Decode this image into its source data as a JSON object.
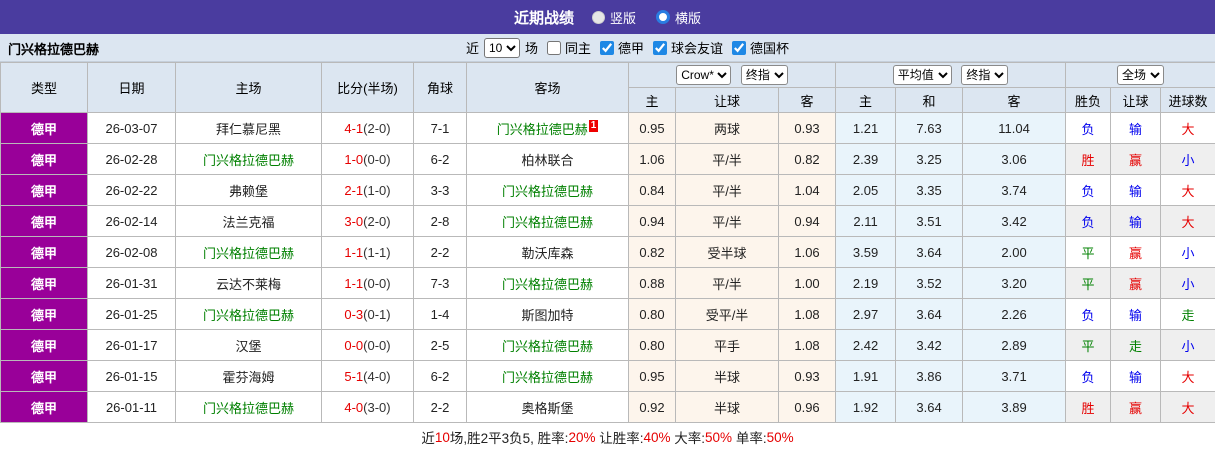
{
  "colors": {
    "topbar_bg": "#4a3c9f",
    "league_cell_bg": "#990099",
    "header_bg": "#dce6f1",
    "odds_bg": "#fdf5ec",
    "avg_bg": "#e9f4fb",
    "alt_row_bg": "#efefef",
    "red": "#e60000",
    "blue": "#0000ee",
    "green": "#008000",
    "checkbox_blue": "#1e88e5"
  },
  "topbar": {
    "title": "近期战绩",
    "radio_vertical": "竖版",
    "radio_horizontal": "横版"
  },
  "filterbar": {
    "team": "门兴格拉德巴赫",
    "near": "近",
    "count": "10",
    "unit": "场",
    "same_home": "同主",
    "league_filters": [
      {
        "label": "德甲",
        "checked": true
      },
      {
        "label": "球会友谊",
        "checked": true
      },
      {
        "label": "德国杯",
        "checked": true
      }
    ]
  },
  "table": {
    "left_headers": [
      "类型",
      "日期",
      "主场",
      "比分(半场)",
      "角球",
      "客场"
    ],
    "selects": {
      "company": "Crow*",
      "stage1": "终指",
      "average": "平均值",
      "stage2": "终指",
      "scope": "全场"
    },
    "sub_headers": [
      "主",
      "让球",
      "客",
      "主",
      "和",
      "客",
      "胜负",
      "让球",
      "进球数"
    ],
    "rows": [
      {
        "type": "德甲",
        "date": "26-03-07",
        "home": {
          "name": "拜仁慕尼黑",
          "color": "black"
        },
        "score": {
          "full": "4-1",
          "half": "(2-0)"
        },
        "corner": "7-1",
        "away": {
          "name": "门兴格拉德巴赫",
          "color": "green",
          "badge": "1"
        },
        "odds": {
          "home": "0.95",
          "handicap": "两球",
          "away": "0.93"
        },
        "avg": {
          "home": "1.21",
          "draw": "7.63",
          "away": "11.04"
        },
        "results": {
          "outcome": {
            "text": "负",
            "color": "blue"
          },
          "handicap": {
            "text": "输",
            "color": "blue"
          },
          "goals": {
            "text": "大",
            "color": "red"
          }
        }
      },
      {
        "type": "德甲",
        "date": "26-02-28",
        "home": {
          "name": "门兴格拉德巴赫",
          "color": "green"
        },
        "score": {
          "full": "1-0",
          "half": "(0-0)"
        },
        "corner": "6-2",
        "away": {
          "name": "柏林联合",
          "color": "black"
        },
        "odds": {
          "home": "1.06",
          "handicap": "平/半",
          "away": "0.82"
        },
        "avg": {
          "home": "2.39",
          "draw": "3.25",
          "away": "3.06"
        },
        "results": {
          "outcome": {
            "text": "胜",
            "color": "red"
          },
          "handicap": {
            "text": "赢",
            "color": "red"
          },
          "goals": {
            "text": "小",
            "color": "blue"
          }
        }
      },
      {
        "type": "德甲",
        "date": "26-02-22",
        "home": {
          "name": "弗赖堡",
          "color": "black"
        },
        "score": {
          "full": "2-1",
          "half": "(1-0)"
        },
        "corner": "3-3",
        "away": {
          "name": "门兴格拉德巴赫",
          "color": "green"
        },
        "odds": {
          "home": "0.84",
          "handicap": "平/半",
          "away": "1.04"
        },
        "avg": {
          "home": "2.05",
          "draw": "3.35",
          "away": "3.74"
        },
        "results": {
          "outcome": {
            "text": "负",
            "color": "blue"
          },
          "handicap": {
            "text": "输",
            "color": "blue"
          },
          "goals": {
            "text": "大",
            "color": "red"
          }
        }
      },
      {
        "type": "德甲",
        "date": "26-02-14",
        "home": {
          "name": "法兰克福",
          "color": "black"
        },
        "score": {
          "full": "3-0",
          "half": "(2-0)"
        },
        "corner": "2-8",
        "away": {
          "name": "门兴格拉德巴赫",
          "color": "green"
        },
        "odds": {
          "home": "0.94",
          "handicap": "平/半",
          "away": "0.94"
        },
        "avg": {
          "home": "2.11",
          "draw": "3.51",
          "away": "3.42"
        },
        "results": {
          "outcome": {
            "text": "负",
            "color": "blue"
          },
          "handicap": {
            "text": "输",
            "color": "blue"
          },
          "goals": {
            "text": "大",
            "color": "red"
          }
        }
      },
      {
        "type": "德甲",
        "date": "26-02-08",
        "home": {
          "name": "门兴格拉德巴赫",
          "color": "green"
        },
        "score": {
          "full": "1-1",
          "half": "(1-1)"
        },
        "corner": "2-2",
        "away": {
          "name": "勒沃库森",
          "color": "black"
        },
        "odds": {
          "home": "0.82",
          "handicap": "受半球",
          "away": "1.06"
        },
        "avg": {
          "home": "3.59",
          "draw": "3.64",
          "away": "2.00"
        },
        "results": {
          "outcome": {
            "text": "平",
            "color": "green"
          },
          "handicap": {
            "text": "赢",
            "color": "red"
          },
          "goals": {
            "text": "小",
            "color": "blue"
          }
        }
      },
      {
        "type": "德甲",
        "date": "26-01-31",
        "home": {
          "name": "云达不莱梅",
          "color": "black"
        },
        "score": {
          "full": "1-1",
          "half": "(0-0)"
        },
        "corner": "7-3",
        "away": {
          "name": "门兴格拉德巴赫",
          "color": "green"
        },
        "odds": {
          "home": "0.88",
          "handicap": "平/半",
          "away": "1.00"
        },
        "avg": {
          "home": "2.19",
          "draw": "3.52",
          "away": "3.20"
        },
        "results": {
          "outcome": {
            "text": "平",
            "color": "green"
          },
          "handicap": {
            "text": "赢",
            "color": "red"
          },
          "goals": {
            "text": "小",
            "color": "blue"
          }
        }
      },
      {
        "type": "德甲",
        "date": "26-01-25",
        "home": {
          "name": "门兴格拉德巴赫",
          "color": "green"
        },
        "score": {
          "full": "0-3",
          "half": "(0-1)"
        },
        "corner": "1-4",
        "away": {
          "name": "斯图加特",
          "color": "black"
        },
        "odds": {
          "home": "0.80",
          "handicap": "受平/半",
          "away": "1.08"
        },
        "avg": {
          "home": "2.97",
          "draw": "3.64",
          "away": "2.26"
        },
        "results": {
          "outcome": {
            "text": "负",
            "color": "blue"
          },
          "handicap": {
            "text": "输",
            "color": "blue"
          },
          "goals": {
            "text": "走",
            "color": "green"
          }
        }
      },
      {
        "type": "德甲",
        "date": "26-01-17",
        "home": {
          "name": "汉堡",
          "color": "black"
        },
        "score": {
          "full": "0-0",
          "half": "(0-0)"
        },
        "corner": "2-5",
        "away": {
          "name": "门兴格拉德巴赫",
          "color": "green"
        },
        "odds": {
          "home": "0.80",
          "handicap": "平手",
          "away": "1.08"
        },
        "avg": {
          "home": "2.42",
          "draw": "3.42",
          "away": "2.89"
        },
        "results": {
          "outcome": {
            "text": "平",
            "color": "green"
          },
          "handicap": {
            "text": "走",
            "color": "green"
          },
          "goals": {
            "text": "小",
            "color": "blue"
          }
        }
      },
      {
        "type": "德甲",
        "date": "26-01-15",
        "home": {
          "name": "霍芬海姆",
          "color": "black"
        },
        "score": {
          "full": "5-1",
          "half": "(4-0)"
        },
        "corner": "6-2",
        "away": {
          "name": "门兴格拉德巴赫",
          "color": "green"
        },
        "odds": {
          "home": "0.95",
          "handicap": "半球",
          "away": "0.93"
        },
        "avg": {
          "home": "1.91",
          "draw": "3.86",
          "away": "3.71"
        },
        "results": {
          "outcome": {
            "text": "负",
            "color": "blue"
          },
          "handicap": {
            "text": "输",
            "color": "blue"
          },
          "goals": {
            "text": "大",
            "color": "red"
          }
        }
      },
      {
        "type": "德甲",
        "date": "26-01-11",
        "home": {
          "name": "门兴格拉德巴赫",
          "color": "green"
        },
        "score": {
          "full": "4-0",
          "half": "(3-0)"
        },
        "corner": "2-2",
        "away": {
          "name": "奥格斯堡",
          "color": "black"
        },
        "odds": {
          "home": "0.92",
          "handicap": "半球",
          "away": "0.96"
        },
        "avg": {
          "home": "1.92",
          "draw": "3.64",
          "away": "3.89"
        },
        "results": {
          "outcome": {
            "text": "胜",
            "color": "red"
          },
          "handicap": {
            "text": "赢",
            "color": "red"
          },
          "goals": {
            "text": "大",
            "color": "red"
          }
        }
      }
    ]
  },
  "summary": {
    "segments": [
      {
        "text": "近",
        "color": "black"
      },
      {
        "text": "10",
        "color": "red"
      },
      {
        "text": "场,胜2平3负5, 胜率:",
        "color": "black"
      },
      {
        "text": "20%",
        "color": "red"
      },
      {
        "text": " 让胜率:",
        "color": "black"
      },
      {
        "text": "40%",
        "color": "red"
      },
      {
        "text": " 大率:",
        "color": "black"
      },
      {
        "text": "50%",
        "color": "red"
      },
      {
        "text": " 单率:",
        "color": "black"
      },
      {
        "text": "50%",
        "color": "red"
      }
    ]
  }
}
